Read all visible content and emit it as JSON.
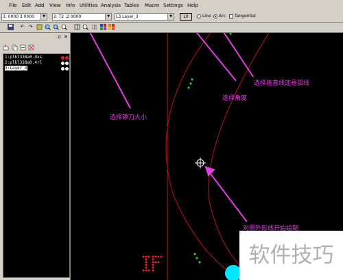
{
  "menu": [
    "File",
    "Edit",
    "Add",
    "View",
    "Info",
    "Utilities",
    "Analysis",
    "Tables",
    "Macro",
    "Settings",
    "Help"
  ],
  "toolbar": {
    "size_value": "3: 0000 3 0000",
    "tool_value": "2: T2 :2 0000",
    "layer_value": "L3 Layer_3",
    "l0_label": "L0",
    "opt_line": "Line",
    "opt_arc": "Arc",
    "tangential_label": "Tangential"
  },
  "layers": [
    {
      "label": "1:plkl338a0.dxs"
    },
    {
      "label": "2:plkl338a0.4rl"
    },
    {
      "label": "3:Layer_3"
    }
  ],
  "annotations": {
    "line_or_arc": "选择画直线还是弧线",
    "angle": "选择角度",
    "tool_size": "选择锣刀大小",
    "outline": "对照外形线开始绘制"
  },
  "watermark": "软件技巧",
  "colors": {
    "annotation": "#e040e0",
    "arc": "#b01818",
    "dots": "#20d020",
    "marker": "#00e5ff",
    "mark_red": "#ff2020"
  }
}
